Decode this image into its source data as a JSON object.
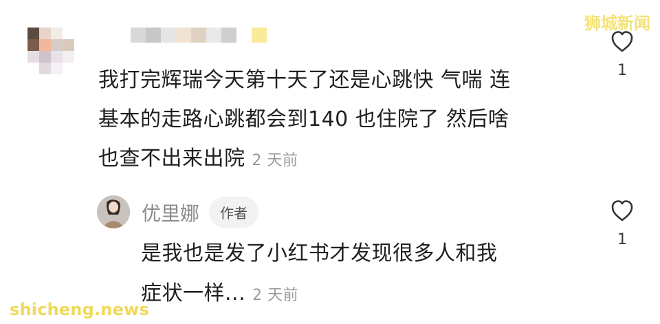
{
  "watermarks": {
    "top_right": "狮城新闻",
    "bottom_left": "shicheng.news"
  },
  "comment": {
    "text_line1": "我打完辉瑞今天第十天了还是心跳快 气喘 连",
    "text_line2": "基本的走路心跳都会到140 也住院了 然后啥",
    "text_line3": "也查不出来出院",
    "time": "2 天前",
    "likes": "1"
  },
  "reply": {
    "username": "优里娜",
    "badge": "作者",
    "text_line1": "是我也是发了小红书才发现很多人和我",
    "text_line2": "症状一样...",
    "time": "2 天前",
    "likes": "1"
  },
  "icons": {
    "like": "heart-outline-icon"
  },
  "colors": {
    "text": "#1f1f1f",
    "meta": "#9a9a9a",
    "badge_bg": "#f2f2f2",
    "watermark": "#f0d95b"
  }
}
